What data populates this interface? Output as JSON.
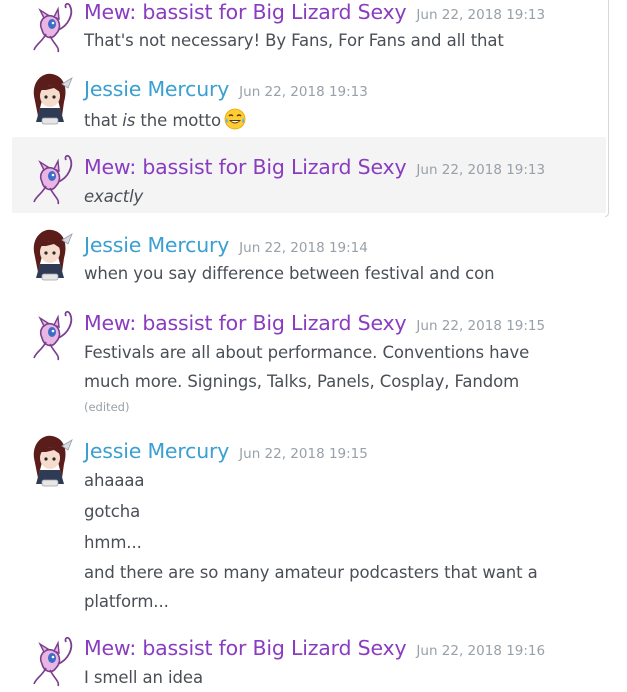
{
  "colors": {
    "mew_name": "#8a3cc0",
    "jessie_name": "#3a9fd1",
    "timestamp": "#98a0a8",
    "text": "#4a4f56",
    "highlight": "#f4f4f5"
  },
  "avatars": {
    "mew": "mew-pokemon-avatar",
    "jessie": "anime-girl-avatar"
  },
  "messages": [
    {
      "author": "Mew: bassist for Big Lizard Sexy",
      "timestamp": "Jun 22, 2018 19:13",
      "lines": [
        "That's not necessary! By Fans, For Fans and all that"
      ]
    },
    {
      "author": "Jessie Mercury",
      "timestamp": "Jun 22, 2018 19:13",
      "parts": {
        "before": "that ",
        "italic": "is",
        "after": " the motto"
      },
      "emoji": "joy-emoji"
    },
    {
      "author": "Mew: bassist for Big Lizard Sexy",
      "timestamp": "Jun 22, 2018 19:13",
      "italic_line": "exactly"
    },
    {
      "author": "Jessie Mercury",
      "timestamp": "Jun 22, 2018 19:14",
      "lines": [
        "when you say difference between festival and con"
      ]
    },
    {
      "author": "Mew: bassist for Big Lizard Sexy",
      "timestamp": "Jun 22, 2018 19:15",
      "lines": [
        "Festivals are all about performance. Conventions have",
        "much more. Signings, Talks, Panels, Cosplay, Fandom"
      ],
      "edited": "(edited)"
    },
    {
      "author": "Jessie Mercury",
      "timestamp": "Jun 22, 2018 19:15",
      "lines": [
        "ahaaaa",
        "gotcha",
        "hmm...",
        "and there are so many amateur podcasters that want a",
        "platform..."
      ]
    },
    {
      "author": "Mew: bassist for Big Lizard Sexy",
      "timestamp": "Jun 22, 2018 19:16",
      "lines": [
        "I smell an idea"
      ]
    }
  ]
}
